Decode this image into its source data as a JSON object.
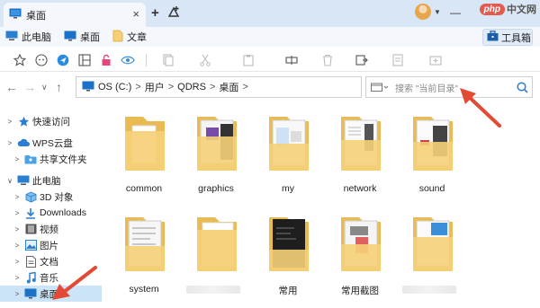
{
  "tab": {
    "title": "桌面",
    "close": "×"
  },
  "tabbar": {
    "new_tab": "+"
  },
  "watermark": {
    "logo": "php",
    "text": "中文网"
  },
  "bookmarks": [
    {
      "label": "此电脑",
      "icon": "monitor-icon"
    },
    {
      "label": "桌面",
      "icon": "desktop-icon"
    },
    {
      "label": "文章",
      "icon": "folder-icon"
    }
  ],
  "toolbox": {
    "label": "工具箱",
    "icon": "toolbox-icon"
  },
  "address": {
    "crumbs": [
      "OS (C:)",
      "用户",
      "QDRS",
      "桌面"
    ],
    "separator": ">"
  },
  "search": {
    "placeholder": "搜索 \"当前目录\""
  },
  "sidebar": {
    "items": [
      {
        "label": "快速访问",
        "icon": "star-icon"
      },
      {
        "label": "WPS云盘",
        "icon": "cloud-icon"
      },
      {
        "label": "共享文件夹",
        "icon": "shared-folder-icon"
      },
      {
        "label": "此电脑",
        "icon": "monitor-icon"
      },
      {
        "label": "3D 对象",
        "icon": "cube-icon"
      },
      {
        "label": "Downloads",
        "icon": "download-icon"
      },
      {
        "label": "视频",
        "icon": "video-icon"
      },
      {
        "label": "图片",
        "icon": "picture-icon"
      },
      {
        "label": "文档",
        "icon": "document-icon"
      },
      {
        "label": "音乐",
        "icon": "music-icon"
      },
      {
        "label": "桌面",
        "icon": "desktop-icon"
      }
    ]
  },
  "folders": [
    {
      "label": "common"
    },
    {
      "label": "graphics"
    },
    {
      "label": "my"
    },
    {
      "label": "network"
    },
    {
      "label": "sound"
    },
    {
      "label": "system"
    },
    {
      "label": ""
    },
    {
      "label": "常用"
    },
    {
      "label": "常用截图"
    },
    {
      "label": ""
    }
  ],
  "colors": {
    "accent": "#1a73c9",
    "folder": "#f5d078",
    "arrow": "#e24a35",
    "selection": "#cce4f7"
  }
}
